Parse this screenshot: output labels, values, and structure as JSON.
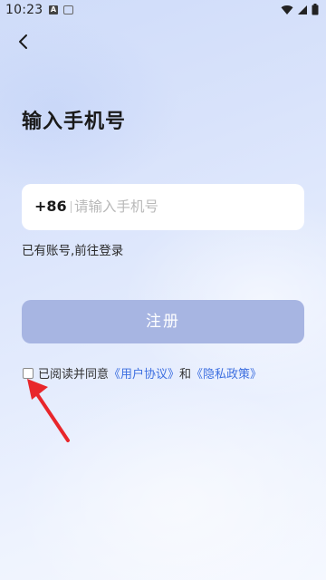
{
  "status_bar": {
    "time": "10:23",
    "notif_icon_1": "A",
    "icons": [
      "notification-a-icon",
      "keyboard-icon",
      "wifi-icon",
      "signal-icon",
      "battery-icon"
    ]
  },
  "nav": {
    "back_icon": "chevron-left-icon"
  },
  "page": {
    "title": "输入手机号"
  },
  "phone": {
    "country_code": "+86",
    "placeholder": "请输入手机号",
    "value": ""
  },
  "login_link": "已有账号,前往登录",
  "register_button": "注册",
  "agreement": {
    "checked": false,
    "prefix": "已阅读并同意",
    "user_agreement": "《用户协议》",
    "conjunction": "和",
    "privacy_policy": "《隐私政策》"
  },
  "colors": {
    "register_button_bg": "#a7b5e2",
    "link": "#3d6fe0",
    "annotation_arrow": "#e8262b"
  }
}
